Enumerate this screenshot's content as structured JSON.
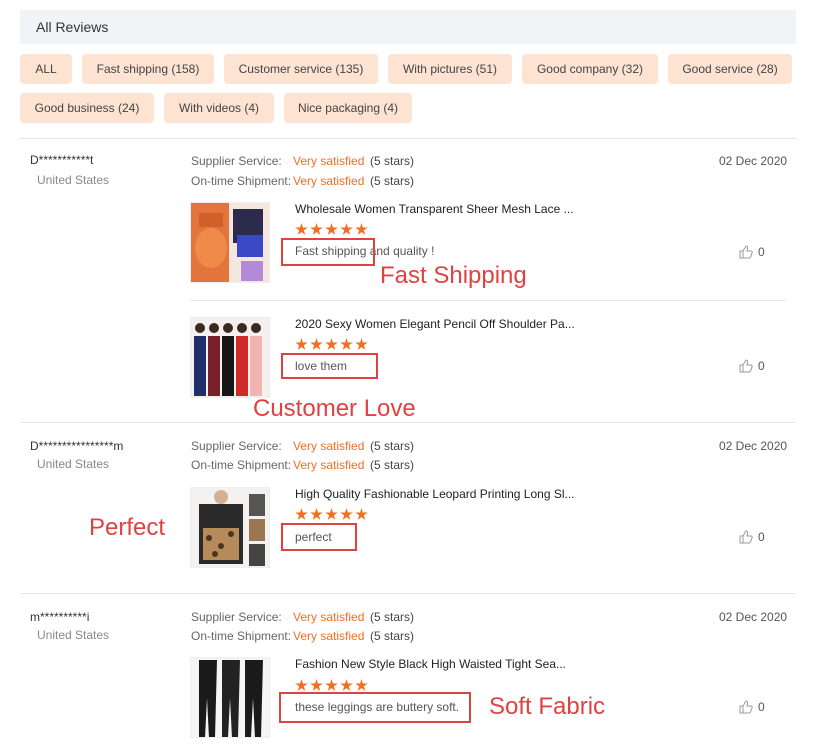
{
  "header": {
    "title": "All Reviews"
  },
  "filters": [
    {
      "label": "ALL"
    },
    {
      "label": "Fast shipping (158)"
    },
    {
      "label": "Customer service (135)"
    },
    {
      "label": "With pictures (51)"
    },
    {
      "label": "Good company (32)"
    },
    {
      "label": "Good service (28)"
    },
    {
      "label": "Good business (24)"
    },
    {
      "label": "With videos (4)"
    },
    {
      "label": "Nice packaging (4)"
    }
  ],
  "labels": {
    "supplier_service": "Supplier Service:",
    "on_time_shipment": "On-time Shipment:",
    "very_satisfied": "Very satisfied",
    "five_stars": "(5 stars)"
  },
  "reviews": [
    {
      "user": "D***********t",
      "country": "United States",
      "date": "02 Dec 2020",
      "items": [
        {
          "title": "Wholesale Women Transparent Sheer Mesh Lace ...",
          "comment": "Fast shipping and quality !",
          "likes": "0",
          "annotation": "Fast Shipping",
          "rating": 5,
          "thumb_icon": "orange-lace-set-photo"
        },
        {
          "title": "2020 Sexy Women Elegant Pencil Off Shoulder Pa...",
          "comment": "love them",
          "likes": "0",
          "annotation": "Customer Love",
          "rating": 5,
          "thumb_icon": "dress-lineup-photo"
        }
      ]
    },
    {
      "user": "D****************m",
      "country": "United States",
      "date": "02 Dec 2020",
      "items": [
        {
          "title": "High Quality Fashionable Leopard Printing Long Sl...",
          "comment": "perfect",
          "likes": "0",
          "annotation": "Perfect",
          "rating": 5,
          "thumb_icon": "leopard-hoodie-photo"
        }
      ]
    },
    {
      "user": "m**********i",
      "country": "United States",
      "date": "02 Dec 2020",
      "items": [
        {
          "title": "Fashion New Style Black High Waisted Tight Sea...",
          "comment": "these leggings are buttery soft.",
          "likes": "0",
          "annotation": "Soft Fabric",
          "rating": 5,
          "thumb_icon": "black-leggings-photo"
        }
      ]
    }
  ],
  "colors": {
    "accent": "#f26f21",
    "chip_bg": "#fde3d2",
    "annotation": "#e04242"
  },
  "icons": {
    "like": "thumbs-up-icon",
    "star": "star-icon"
  }
}
